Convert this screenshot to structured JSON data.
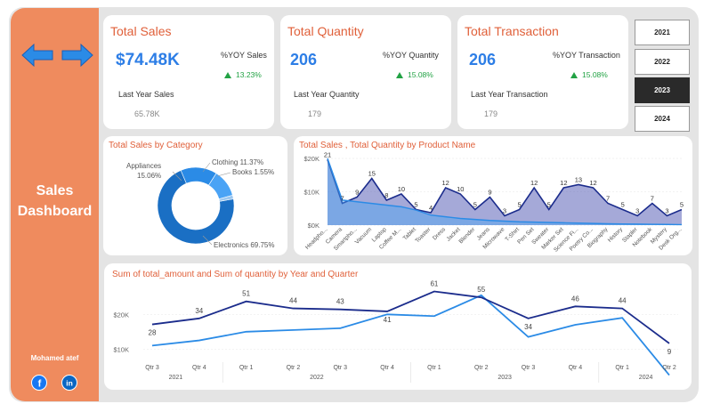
{
  "sidebar": {
    "title_line1": "Sales",
    "title_line2": "Dashboard",
    "author": "Mohamed atef",
    "icons": [
      "arrow-left-icon",
      "arrow-right-icon",
      "facebook-icon",
      "linkedin-icon"
    ],
    "accent": "#ef8b5e"
  },
  "kpis": [
    {
      "title": "Total Sales",
      "value": "$74.48K",
      "yoy_label": "%YOY Sales",
      "yoy_value": "13.23%",
      "ly_label": "Last Year Sales",
      "ly_value": "65.78K"
    },
    {
      "title": "Total Quantity",
      "value": "206",
      "yoy_label": "%YOY Quantity",
      "yoy_value": "15.08%",
      "ly_label": "Last Year Quantity",
      "ly_value": "179"
    },
    {
      "title": "Total Transaction",
      "value": "206",
      "yoy_label": "%YOY Transaction",
      "yoy_value": "15.08%",
      "ly_label": "Last Year Transaction",
      "ly_value": "179"
    }
  ],
  "years": {
    "options": [
      "2021",
      "2022",
      "2023",
      "2024"
    ],
    "selected": "2023"
  },
  "category_title": "Total Sales by Category",
  "product_title": "Total Sales , Total Quantity by Product Name",
  "quarter_title": "Sum of total_amount and Sum of quantity by Year and Quarter",
  "colors": {
    "title": "#e0603a",
    "value": "#2d7ee6",
    "positive": "#22a244",
    "dark_series": "#1b2c8c",
    "light_series": "#2b8be6"
  },
  "chart_data": [
    {
      "type": "pie",
      "title": "Total Sales by Category",
      "style": "donut",
      "categories": [
        "Electronics",
        "Clothing",
        "Appliances",
        "Books"
      ],
      "values": [
        69.75,
        11.37,
        15.06,
        1.55
      ],
      "labels": [
        "Electronics 69.75%",
        "Clothing 11.37%",
        "Appliances 15.06%",
        "Books 1.55%"
      ],
      "colors": [
        "#1a6fc4",
        "#4aa3f5",
        "#2b8be6",
        "#9cc7f0"
      ]
    },
    {
      "type": "area",
      "title": "Total Sales , Total Quantity by Product Name",
      "categories": [
        "Headpho...",
        "Camera",
        "Smartpho...",
        "Vacuum",
        "Laptop",
        "Coffee M...",
        "Tablet",
        "Toaster",
        "Dress",
        "Jacket",
        "Blender",
        "Jeans",
        "Microwave",
        "T-Shirt",
        "Pen Set",
        "Sweater",
        "Marker Set",
        "Science Fi...",
        "Poetry Co...",
        "Biography",
        "History",
        "Stapler",
        "Notebook",
        "Mystery",
        "Desk Org..."
      ],
      "y_ticks": [
        "$0K",
        "$10K",
        "$20K"
      ],
      "ylim": [
        0,
        20000
      ],
      "series": [
        {
          "name": "Total Sales",
          "style": "area",
          "values": [
            20000,
            7500,
            7000,
            6500,
            6000,
            5500,
            4500,
            3000,
            2500,
            2000,
            1700,
            1400,
            1200,
            1000,
            900,
            800,
            700,
            600,
            500,
            400,
            350,
            300,
            250,
            200,
            150
          ]
        },
        {
          "name": "Total Quantity",
          "style": "line-area",
          "values": [
            21,
            7,
            9,
            15,
            8,
            10,
            5,
            4,
            12,
            10,
            5,
            9,
            3,
            5,
            12,
            5,
            12,
            13,
            12,
            7,
            5,
            3,
            7,
            3,
            5
          ]
        }
      ]
    },
    {
      "type": "line",
      "title": "Sum of total_amount and Sum of quantity by Year and Quarter",
      "categories": [
        "Qtr 3",
        "Qtr 4",
        "Qtr 1",
        "Qtr 2",
        "Qtr 3",
        "Qtr 4",
        "Qtr 1",
        "Qtr 2",
        "Qtr 3",
        "Qtr 4",
        "Qtr 1",
        "Qtr 2"
      ],
      "year_groups": [
        {
          "year": "2021",
          "quarters": 2
        },
        {
          "year": "2022",
          "quarters": 4
        },
        {
          "year": "2023",
          "quarters": 4
        },
        {
          "year": "2024",
          "quarters": 2
        }
      ],
      "y_ticks": [
        "$10K",
        "$20K"
      ],
      "ylim": [
        7000,
        27000
      ],
      "series": [
        {
          "name": "Sum of total_amount",
          "color": "#2b8be6",
          "values": [
            11000,
            12500,
            15000,
            15500,
            16000,
            20000,
            19500,
            25500,
            13500,
            17000,
            19000,
            2500
          ]
        },
        {
          "name": "Sum of quantity",
          "color": "#1b2c8c",
          "values": [
            28,
            34,
            51,
            44,
            43,
            41,
            61,
            55,
            34,
            46,
            44,
            9
          ]
        }
      ]
    }
  ]
}
